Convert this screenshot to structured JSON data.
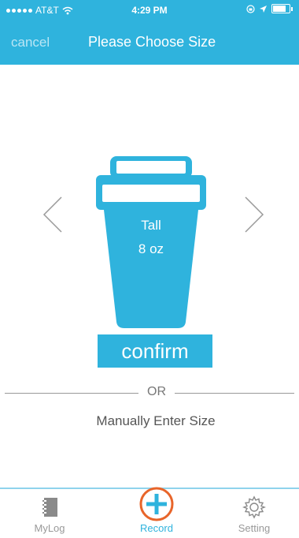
{
  "status_bar": {
    "carrier": "AT&T",
    "time": "4:29 PM"
  },
  "nav": {
    "cancel_label": "cancel",
    "title": "Please Choose Size"
  },
  "cup": {
    "size_name": "Tall",
    "volume": "8 oz"
  },
  "confirm_label": "confirm",
  "or_label": "OR",
  "manual_label": "Manually Enter Size",
  "tabs": [
    {
      "label": "MyLog",
      "icon": "notebook-icon"
    },
    {
      "label": "Record",
      "icon": "plus-circle-icon"
    },
    {
      "label": "Setting",
      "icon": "gear-icon"
    }
  ],
  "colors": {
    "accent": "#2fb3dd",
    "record_ring": "#e8652a"
  }
}
